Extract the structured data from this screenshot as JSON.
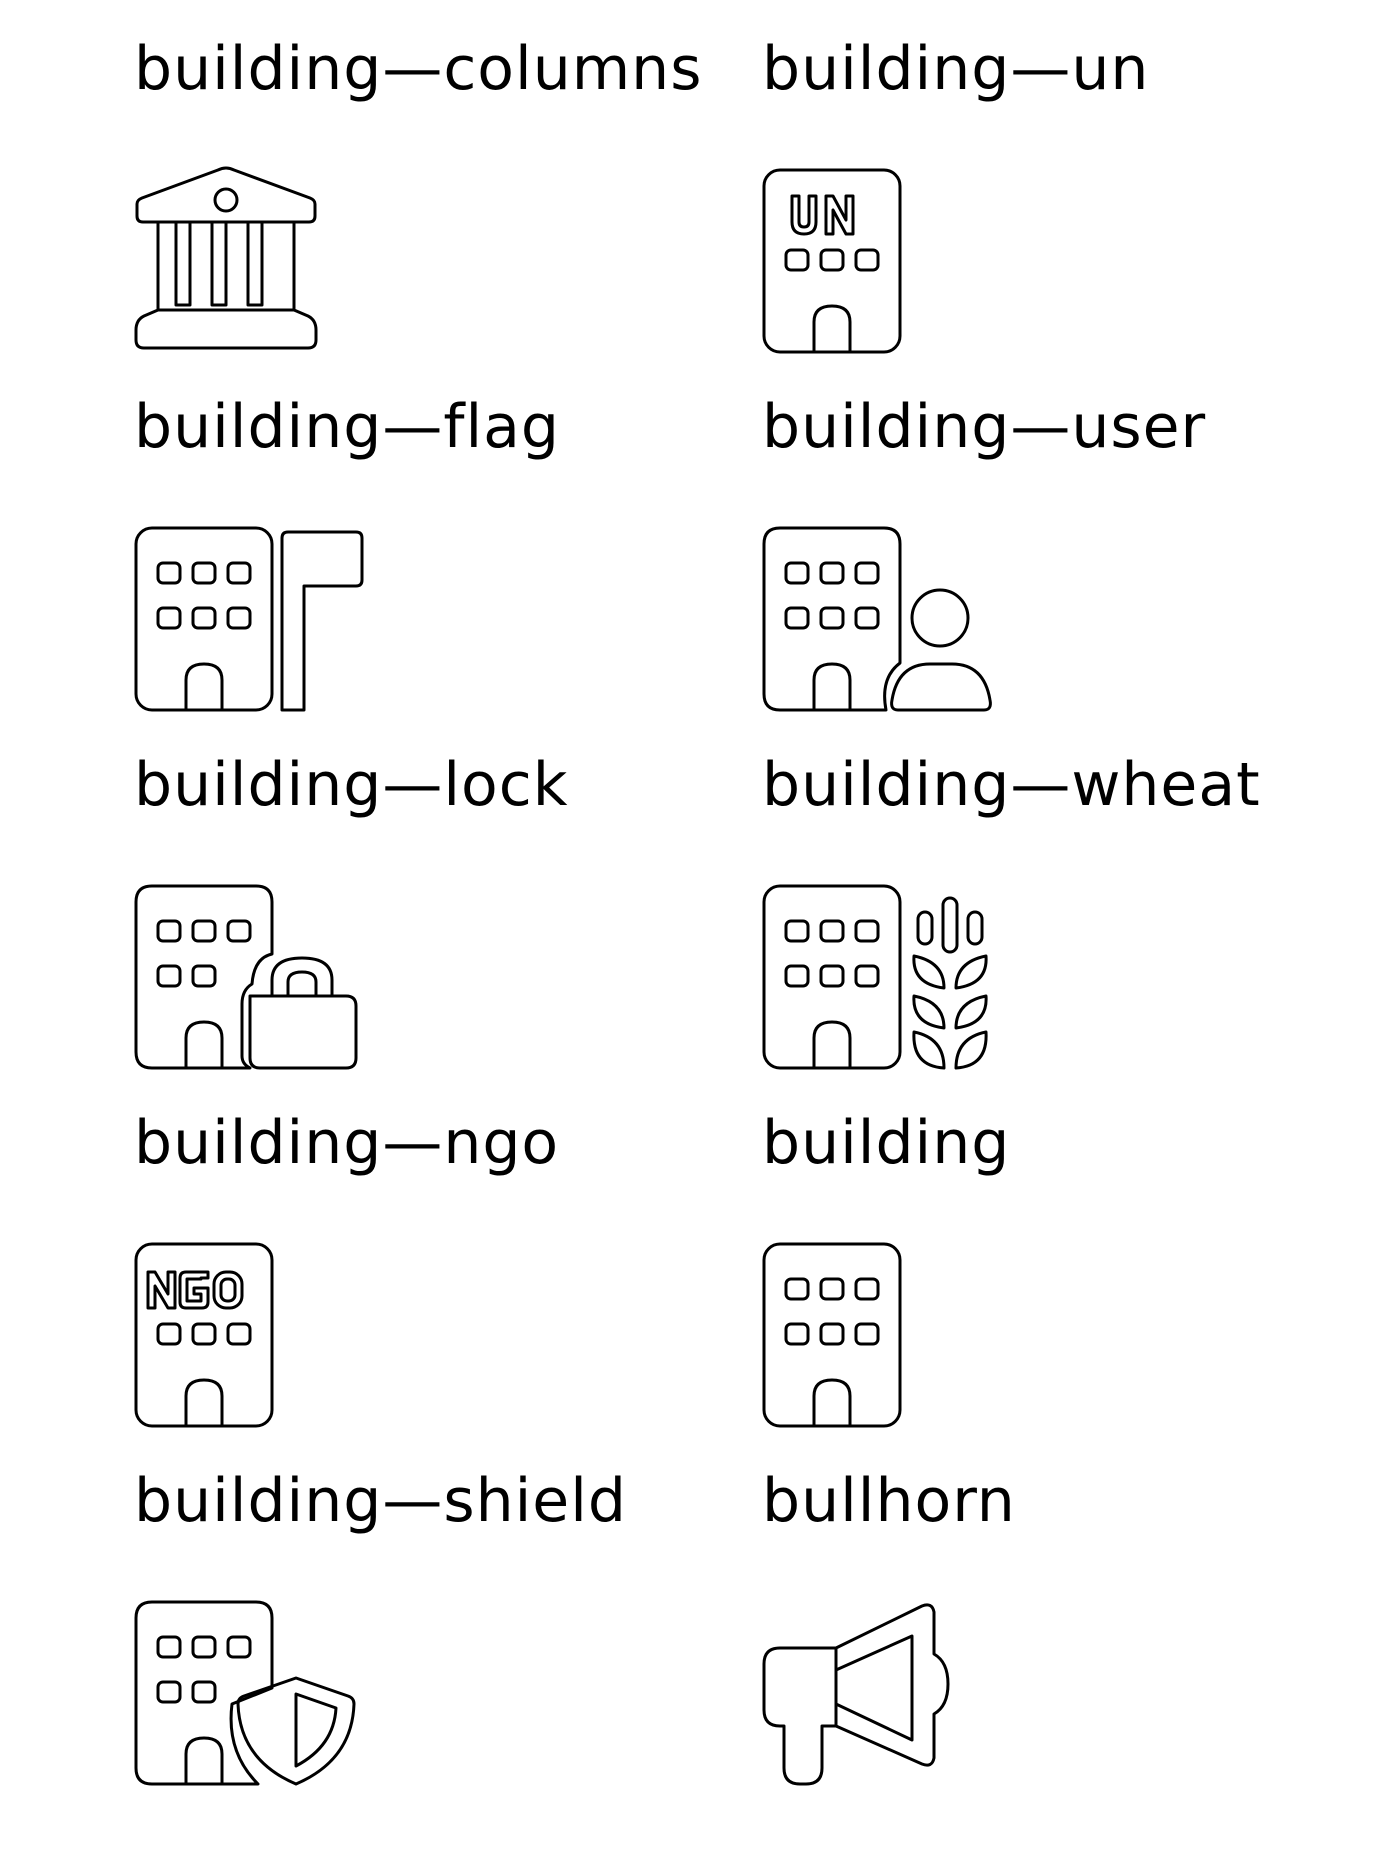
{
  "icons": [
    {
      "label": "building—columns",
      "icon": "building-columns-icon"
    },
    {
      "label": "building—un",
      "icon": "building-un-icon"
    },
    {
      "label": "building—flag",
      "icon": "building-flag-icon"
    },
    {
      "label": "building—user",
      "icon": "building-user-icon"
    },
    {
      "label": "building—lock",
      "icon": "building-lock-icon"
    },
    {
      "label": "building—wheat",
      "icon": "building-wheat-icon"
    },
    {
      "label": "building—ngo",
      "icon": "building-ngo-icon"
    },
    {
      "label": "building",
      "icon": "building-icon"
    },
    {
      "label": "building—shield",
      "icon": "building-shield-icon"
    },
    {
      "label": "bullhorn",
      "icon": "bullhorn-icon"
    }
  ]
}
